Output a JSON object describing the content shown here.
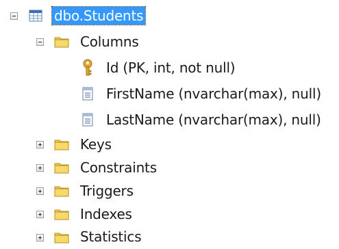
{
  "tree": {
    "table": {
      "label": "dbo.Students",
      "icon": "table-icon",
      "expanded": true,
      "selected": true
    },
    "columns_folder": {
      "label": "Columns",
      "icon": "folder-icon",
      "expanded": true
    },
    "columns": [
      {
        "label": "Id (PK, int, not null)",
        "icon": "primary-key-icon"
      },
      {
        "label": "FirstName (nvarchar(max), null)",
        "icon": "column-icon"
      },
      {
        "label": "LastName (nvarchar(max), null)",
        "icon": "column-icon"
      }
    ],
    "folders": [
      {
        "label": "Keys",
        "icon": "folder-icon",
        "expanded": false
      },
      {
        "label": "Constraints",
        "icon": "folder-icon",
        "expanded": false
      },
      {
        "label": "Triggers",
        "icon": "folder-icon",
        "expanded": false
      },
      {
        "label": "Indexes",
        "icon": "folder-icon",
        "expanded": false
      },
      {
        "label": "Statistics",
        "icon": "folder-icon",
        "expanded": false
      }
    ]
  },
  "colors": {
    "selection": "#3399ff",
    "folder": "#f2c94c",
    "key": "#e0a82e",
    "table_header": "#3a6fb5"
  }
}
